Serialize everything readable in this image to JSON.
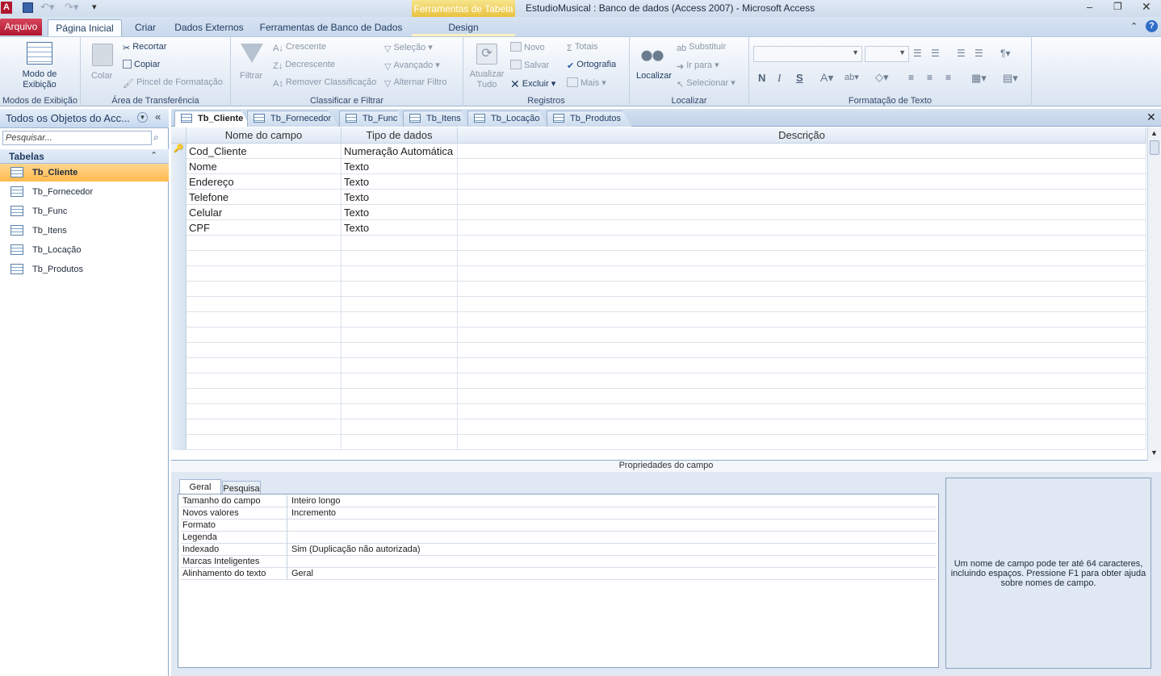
{
  "window": {
    "title": "EstudioMusical : Banco de dados (Access 2007)  -  Microsoft Access",
    "context_header": "Ferramentas de Tabela"
  },
  "ribbon_tabs": {
    "file": "Arquivo",
    "home": "Página Inicial",
    "create": "Criar",
    "external": "Dados Externos",
    "db_tools": "Ferramentas de Banco de Dados",
    "design": "Design"
  },
  "ribbon": {
    "views": {
      "label": "Modos de Exibição",
      "button": "Modo de Exibição"
    },
    "clipboard": {
      "label": "Área de Transferência",
      "paste": "Colar",
      "cut": "Recortar",
      "copy": "Copiar",
      "format_painter": "Pincel de Formatação"
    },
    "sort_filter": {
      "label": "Classificar e Filtrar",
      "filter": "Filtrar",
      "asc": "Crescente",
      "desc": "Decrescente",
      "remove_sort": "Remover Classificação",
      "selection": "Seleção",
      "advanced": "Avançado",
      "toggle_filter": "Alternar Filtro"
    },
    "records": {
      "label": "Registros",
      "refresh": "Atualizar Tudo",
      "new": "Novo",
      "save": "Salvar",
      "delete": "Excluir",
      "totals": "Totais",
      "spelling": "Ortografia",
      "more": "Mais"
    },
    "find": {
      "label": "Localizar",
      "find": "Localizar",
      "replace": "Substituir",
      "goto": "Ir para",
      "select": "Selecionar"
    },
    "text_format": {
      "label": "Formatação de Texto",
      "bold": "N",
      "italic": "I",
      "underline": "S"
    }
  },
  "nav": {
    "header": "Todos os Objetos do Acc...",
    "search_placeholder": "Pesquisar...",
    "group": "Tabelas",
    "items": [
      "Tb_Cliente",
      "Tb_Fornecedor",
      "Tb_Func",
      "Tb_Itens",
      "Tb_Locação",
      "Tb_Produtos"
    ]
  },
  "doc_tabs": [
    "Tb_Cliente",
    "Tb_Fornecedor",
    "Tb_Func",
    "Tb_Itens",
    "Tb_Locação",
    "Tb_Produtos"
  ],
  "grid": {
    "headers": {
      "name": "Nome do campo",
      "type": "Tipo de dados",
      "desc": "Descrição"
    },
    "rows": [
      {
        "name": "Cod_Cliente",
        "type": "Numeração Automática",
        "desc": ""
      },
      {
        "name": "Nome",
        "type": "Texto",
        "desc": ""
      },
      {
        "name": "Endereço",
        "type": "Texto",
        "desc": ""
      },
      {
        "name": "Telefone",
        "type": "Texto",
        "desc": ""
      },
      {
        "name": "Celular",
        "type": "Texto",
        "desc": ""
      },
      {
        "name": "CPF",
        "type": "Texto",
        "desc": ""
      }
    ]
  },
  "props": {
    "title": "Propriedades do campo",
    "tab_general": "Geral",
    "tab_lookup": "Pesquisa",
    "rows": [
      {
        "k": "Tamanho do campo",
        "v": "Inteiro longo"
      },
      {
        "k": "Novos valores",
        "v": "Incremento"
      },
      {
        "k": "Formato",
        "v": ""
      },
      {
        "k": "Legenda",
        "v": ""
      },
      {
        "k": "Indexado",
        "v": "Sim (Duplicação não autorizada)"
      },
      {
        "k": "Marcas Inteligentes",
        "v": ""
      },
      {
        "k": "Alinhamento do texto",
        "v": "Geral"
      }
    ],
    "help": "Um nome de campo pode ter até 64 caracteres, incluindo espaços. Pressione F1 para obter ajuda sobre nomes de campo."
  }
}
